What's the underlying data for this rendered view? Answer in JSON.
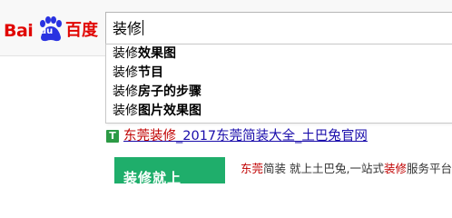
{
  "logo": {
    "bai": "Bai",
    "du": "du",
    "cn": "百度",
    "color": "#e10602"
  },
  "search": {
    "value": "装修"
  },
  "suggestions": [
    {
      "prefix": "装修",
      "rest": "效果图"
    },
    {
      "prefix": "装修",
      "rest": "节目"
    },
    {
      "prefix": "装修",
      "rest": "房子的步骤"
    },
    {
      "prefix": "装修",
      "rest": "图片效果图"
    }
  ],
  "result": {
    "icon_label": "T",
    "title_highlight": "东莞装修",
    "title_rest": "_2017东莞简装大全_土巴兔官网",
    "thumb_text": "装修就上",
    "abstract_highlight1": "东莞",
    "abstract_mid": "简装 就上土巴兔,一站式",
    "abstract_highlight2": "装修",
    "abstract_end": "服务平台"
  },
  "colors": {
    "link": "#1a0dab",
    "highlight": "#c00000",
    "thumb_bg": "#1fae6b",
    "icon_bg": "#2c9a45"
  }
}
